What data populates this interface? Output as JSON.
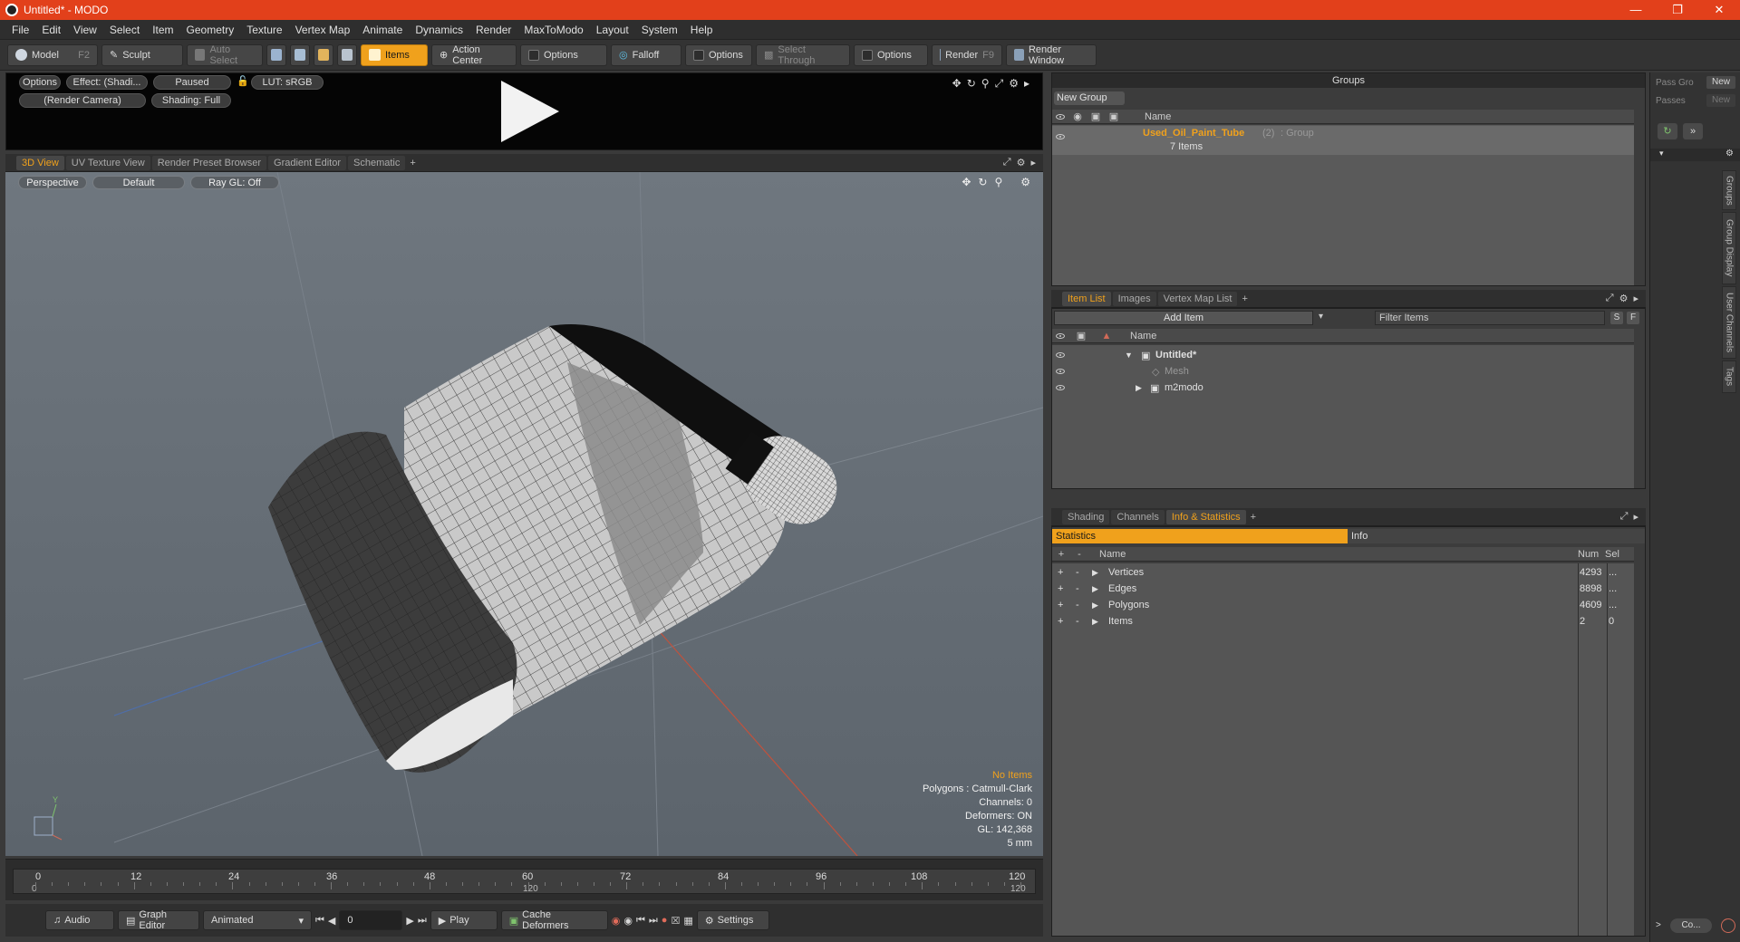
{
  "window": {
    "title": "Untitled* - MODO"
  },
  "menu": [
    "File",
    "Edit",
    "View",
    "Select",
    "Item",
    "Geometry",
    "Texture",
    "Vertex Map",
    "Animate",
    "Dynamics",
    "Render",
    "MaxToModo",
    "Layout",
    "System",
    "Help"
  ],
  "toolbar": {
    "model": "Model",
    "model_key": "F2",
    "sculpt": "Sculpt",
    "auto_select": "Auto Select",
    "items": "Items",
    "action_center": "Action Center",
    "options1": "Options",
    "falloff": "Falloff",
    "options2": "Options",
    "select_through": "Select Through",
    "options3": "Options",
    "render": "Render",
    "render_key": "F9",
    "render_window": "Render Window"
  },
  "preview": {
    "options": "Options",
    "effect": "Effect: (Shadi...",
    "paused": "Paused",
    "lut": "LUT: sRGB",
    "camera": "(Render Camera)",
    "shading": "Shading: Full"
  },
  "viewport_tabs": [
    "3D View",
    "UV Texture View",
    "Render Preset Browser",
    "Gradient Editor",
    "Schematic",
    "+"
  ],
  "viewport": {
    "perspective": "Perspective",
    "default": "Default",
    "raygl": "Ray GL: Off",
    "info": {
      "no_items": "No Items",
      "polygons": "Polygons : Catmull-Clark",
      "channels": "Channels: 0",
      "deformers": "Deformers: ON",
      "gl": "GL: 142,368",
      "scale": "5 mm"
    }
  },
  "timeline": {
    "ticks": [
      "0",
      "12",
      "24",
      "36",
      "48",
      "60",
      "72",
      "84",
      "96",
      "108",
      "120"
    ],
    "sub": [
      "0",
      "120",
      "120"
    ]
  },
  "bottom": {
    "audio": "Audio",
    "graph_editor": "Graph Editor",
    "animated": "Animated",
    "frame": "0",
    "play": "Play",
    "cache": "Cache Deformers",
    "settings": "Settings"
  },
  "groups": {
    "title": "Groups",
    "new_group": "New Group",
    "col_name": "Name",
    "item_name": "Used_Oil_Paint_Tube",
    "item_count": "(2)",
    "item_type": ": Group",
    "item_sub": "7 Items"
  },
  "item_list": {
    "tabs": [
      "Item List",
      "Images",
      "Vertex Map List",
      "+"
    ],
    "add_item": "Add Item",
    "filter": "Filter Items",
    "s": "S",
    "f": "F",
    "col_name": "Name",
    "rows": [
      "Untitled*",
      "Mesh",
      "m2modo"
    ]
  },
  "stats": {
    "tabs": [
      "Shading",
      "Channels",
      "Info & Statistics",
      "+"
    ],
    "statistics": "Statistics",
    "info": "Info",
    "col_name": "Name",
    "col_num": "Num",
    "col_sel": "Sel",
    "rows": [
      {
        "name": "Vertices",
        "num": "4293",
        "sel": "..."
      },
      {
        "name": "Edges",
        "num": "8898",
        "sel": "..."
      },
      {
        "name": "Polygons",
        "num": "4609",
        "sel": "..."
      },
      {
        "name": "Items",
        "num": "2",
        "sel": "0"
      }
    ]
  },
  "right_strip": {
    "pass_gro": "Pass Gro",
    "new1": "New",
    "passes": "Passes",
    "new2": "New",
    "vtabs": [
      "Groups",
      "Group Display",
      "User Channels",
      "Tags"
    ],
    "co": "Co..."
  }
}
